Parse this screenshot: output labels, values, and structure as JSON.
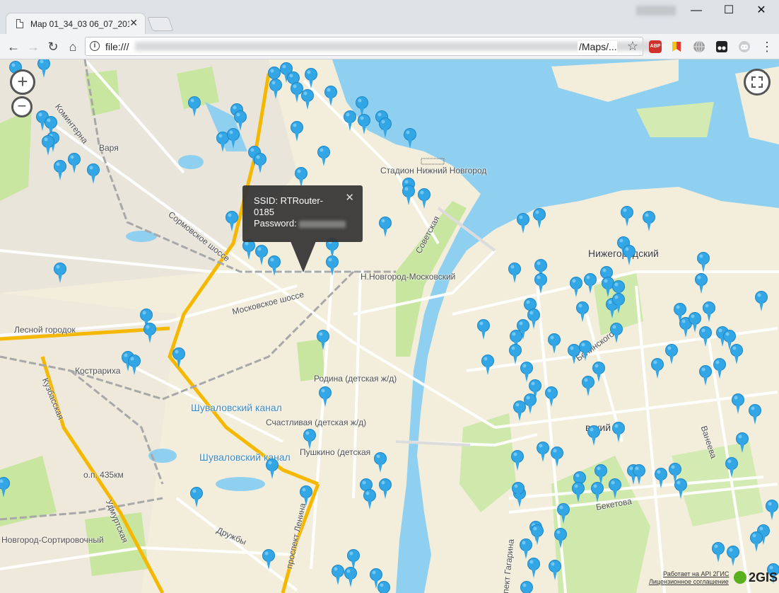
{
  "browser": {
    "tab_title": "Map 01_34_03 06_07_201",
    "tab_close": "✕",
    "window_controls": {
      "minimize": "—",
      "maximize": "☐",
      "close": "✕"
    },
    "nav": {
      "back": "←",
      "forward": "→",
      "reload": "↻",
      "home": "⌂"
    },
    "url_prefix": "file:///",
    "url_suffix": "/Maps/...",
    "bookmark": "☆",
    "menu": "⋮",
    "extensions": [
      "adblock-plus-icon",
      "bookmark-flag-icon",
      "globe-icon",
      "tampermonkey-icon",
      "discord-icon"
    ],
    "adblock_label": "ABP"
  },
  "map": {
    "zoom_in": "+",
    "zoom_out": "−",
    "labels": [
      "Коминтерна",
      "Варя",
      "Стадион Нижний Новгород",
      "Сормовское шоссе",
      "Советская",
      "Нижегородский",
      "Н.Новгород-Московский",
      "Московское шоссе",
      "Лесной городок",
      "Кострариха",
      "Родина (детская ж/д)",
      "Белинского",
      "Кузбасская",
      "Шуваловский канал",
      "Шуваловский канал",
      "Счастливая (детская ж/д)",
      "Пушкино (детская",
      "вский",
      "Ванеева",
      "о.п. 435км",
      "Удмуртская",
      "Бекетова",
      "Дружбы",
      "проспект Ленина",
      "Новгород-Сортировочный",
      "пект Гагарина"
    ],
    "popup": {
      "ssid_line1": "SSID: RTRouter-",
      "ssid_line2": "0185",
      "password_label": "Password:",
      "close": "✕"
    },
    "attribution": {
      "line1": "Работает на API 2ГИС",
      "line2": "Лицензионное соглашение",
      "logo": "2GIS"
    },
    "colors": {
      "water": "#8fd0f0",
      "park": "#c8e6a0",
      "pin": "#33a6e6",
      "highway": "#f5b800"
    }
  }
}
